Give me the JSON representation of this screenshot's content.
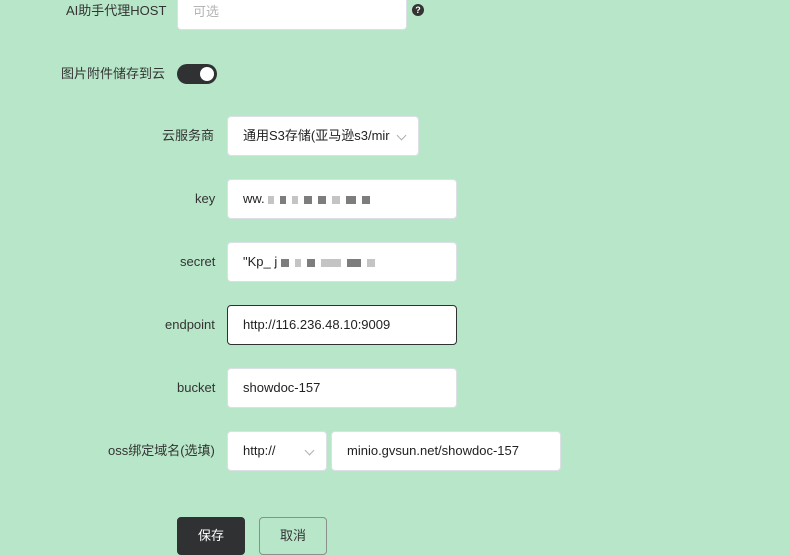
{
  "form": {
    "ai_host": {
      "label": "AI助手代理HOST",
      "placeholder": "可选",
      "help": "?"
    },
    "cloud_storage": {
      "label": "图片附件储存到云",
      "enabled": true
    },
    "provider": {
      "label": "云服务商",
      "value": "通用S3存储(亚马逊s3/mir"
    },
    "key": {
      "label": "key",
      "value": "ww."
    },
    "secret": {
      "label": "secret",
      "value": "\"Kp_ j"
    },
    "endpoint": {
      "label": "endpoint",
      "value": "http://116.236.48.10:9009"
    },
    "bucket": {
      "label": "bucket",
      "value": "showdoc-157"
    },
    "oss_domain": {
      "label": "oss绑定域名(选填)",
      "protocol": "http://",
      "value": "minio.gvsun.net/showdoc-157"
    }
  },
  "actions": {
    "save_label": "保存",
    "cancel_label": "取消"
  }
}
